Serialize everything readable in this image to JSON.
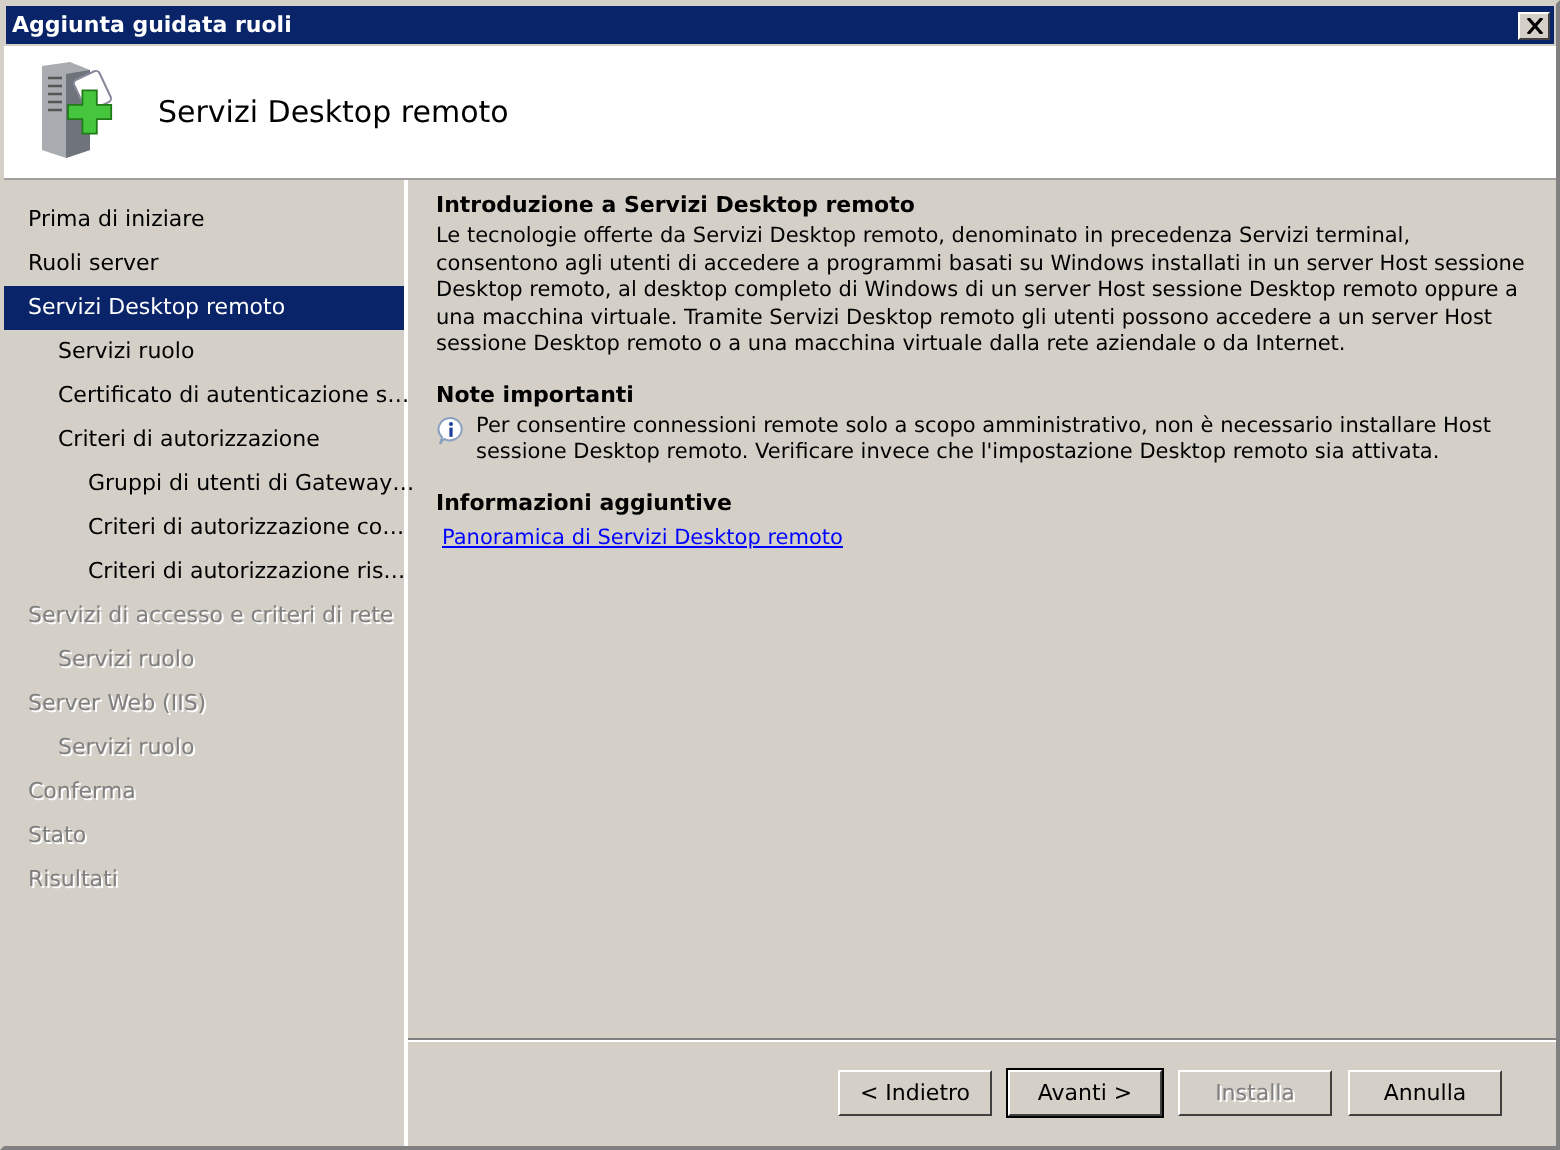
{
  "window": {
    "title": "Aggiunta guidata ruoli"
  },
  "header": {
    "title": "Servizi Desktop remoto"
  },
  "sidebar": {
    "items": [
      {
        "label": "Prima di iniziare",
        "selected": false,
        "disabled": false
      },
      {
        "label": "Ruoli server",
        "selected": false,
        "disabled": false
      },
      {
        "label": "Servizi Desktop remoto",
        "selected": true,
        "disabled": false,
        "children": [
          {
            "label": "Servizi ruolo",
            "selected": false,
            "disabled": false
          },
          {
            "label": "Certificato di autenticazione s…",
            "selected": false,
            "disabled": false
          },
          {
            "label": "Criteri di autorizzazione",
            "selected": false,
            "disabled": false,
            "children": [
              {
                "label": "Gruppi di utenti di Gateway…",
                "selected": false,
                "disabled": false
              },
              {
                "label": "Criteri di autorizzazione co…",
                "selected": false,
                "disabled": false
              },
              {
                "label": "Criteri di autorizzazione ris…",
                "selected": false,
                "disabled": false
              }
            ]
          }
        ]
      },
      {
        "label": "Servizi di accesso e criteri di rete",
        "selected": false,
        "disabled": true,
        "children": [
          {
            "label": "Servizi ruolo",
            "selected": false,
            "disabled": true
          }
        ]
      },
      {
        "label": "Server Web (IIS)",
        "selected": false,
        "disabled": true,
        "children": [
          {
            "label": "Servizi ruolo",
            "selected": false,
            "disabled": true
          }
        ]
      },
      {
        "label": "Conferma",
        "selected": false,
        "disabled": true
      },
      {
        "label": "Stato",
        "selected": false,
        "disabled": true
      },
      {
        "label": "Risultati",
        "selected": false,
        "disabled": true
      }
    ]
  },
  "content": {
    "sections": [
      {
        "kind": "text",
        "heading": "Introduzione a Servizi Desktop remoto",
        "body": "Le tecnologie offerte da Servizi Desktop remoto, denominato in precedenza Servizi terminal, consentono agli utenti di accedere a programmi basati su Windows installati in un server Host sessione Desktop remoto, al desktop completo di Windows di un server Host sessione Desktop remoto oppure a una macchina virtuale. Tramite Servizi Desktop remoto gli utenti possono accedere a un server Host sessione Desktop remoto o a una macchina virtuale dalla rete aziendale o da Internet."
      },
      {
        "kind": "note",
        "heading": "Note importanti",
        "body": "Per consentire connessioni remote solo a scopo amministrativo, non è necessario installare Host sessione Desktop remoto. Verificare invece che l'impostazione Desktop remoto sia attivata."
      },
      {
        "kind": "link",
        "heading": "Informazioni aggiuntive",
        "body": "Panoramica di Servizi Desktop remoto"
      }
    ]
  },
  "buttons": [
    {
      "label": "< Indietro",
      "disabled": false,
      "default": false
    },
    {
      "label": "Avanti >",
      "disabled": false,
      "default": true
    },
    {
      "label": "Installa",
      "disabled": true,
      "default": false
    },
    {
      "label": "Annulla",
      "disabled": false,
      "default": false
    }
  ]
}
